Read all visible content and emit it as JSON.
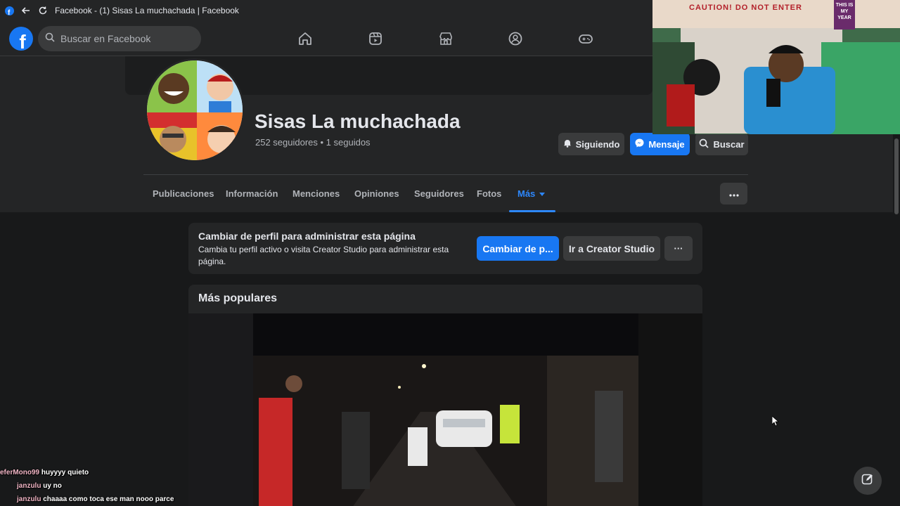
{
  "window": {
    "title": "Facebook - (1) Sisas La muchachada | Facebook"
  },
  "nav": {
    "search_placeholder": "Buscar en Facebook",
    "icons": [
      "home-icon",
      "reels-icon",
      "marketplace-icon",
      "groups-icon",
      "gaming-icon"
    ]
  },
  "profile": {
    "name": "Sisas La muchachada",
    "stats": "252 seguidores • 1 seguidos",
    "buttons": {
      "following": "Siguiendo",
      "message": "Mensaje",
      "search": "Buscar"
    }
  },
  "tabs": [
    {
      "label": "Publicaciones"
    },
    {
      "label": "Información"
    },
    {
      "label": "Menciones"
    },
    {
      "label": "Opiniones"
    },
    {
      "label": "Seguidores"
    },
    {
      "label": "Fotos"
    },
    {
      "label": "Más",
      "active": true
    }
  ],
  "admin_card": {
    "title": "Cambiar de perfil para administrar esta página",
    "description": "Cambia tu perfil activo o visita Creator Studio para administrar esta página.",
    "switch_button": "Cambiar de p...",
    "creator_button": "Ir a Creator Studio",
    "more_button": "···"
  },
  "popular": {
    "title": "Más populares"
  },
  "webcam": {
    "banner": "CAUTION! DO NOT ENTER",
    "sign": "THIS IS MY YEAR"
  },
  "chat": [
    {
      "user": "eferMono99",
      "message": "huyyyy quieto"
    },
    {
      "user": "janzulu",
      "message": "uy no"
    },
    {
      "user": "janzulu",
      "message": "chaaaa como toca ese man nooo parce"
    }
  ],
  "colors": {
    "accent": "#1877f2",
    "active_tab": "#2d88ff",
    "bg": "#18191a",
    "card": "#242526"
  }
}
